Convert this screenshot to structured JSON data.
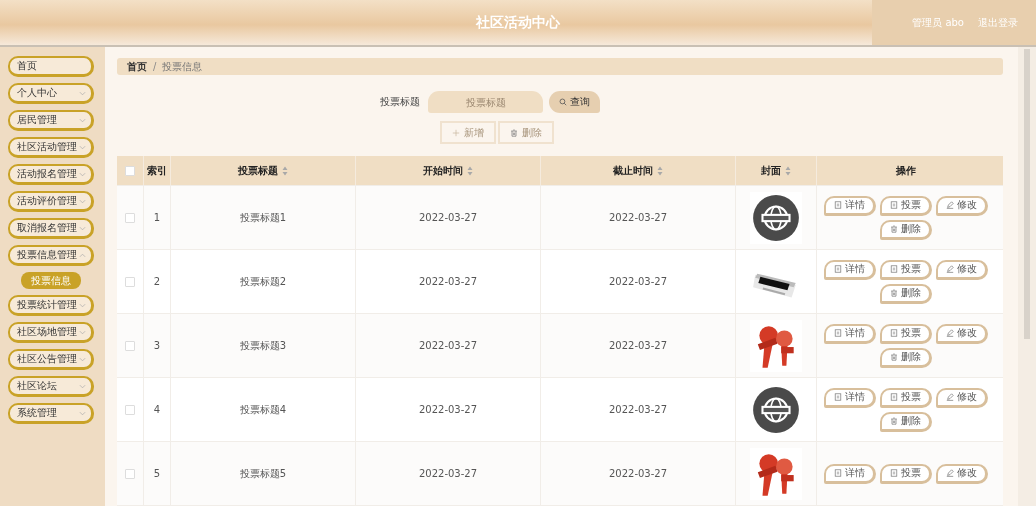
{
  "header": {
    "title": "社区活动中心",
    "user": "管理员 abo",
    "logout": "退出登录"
  },
  "sidebar": {
    "items": [
      {
        "label": "首页",
        "kind": "link"
      },
      {
        "label": "个人中心",
        "kind": "menu",
        "expanded": false
      },
      {
        "label": "居民管理",
        "kind": "menu",
        "expanded": false
      },
      {
        "label": "社区活动管理",
        "kind": "menu",
        "expanded": false
      },
      {
        "label": "活动报名管理",
        "kind": "menu",
        "expanded": false
      },
      {
        "label": "活动评价管理",
        "kind": "menu",
        "expanded": false
      },
      {
        "label": "取消报名管理",
        "kind": "menu",
        "expanded": false
      },
      {
        "label": "投票信息管理",
        "kind": "menu",
        "expanded": true,
        "children": [
          {
            "label": "投票信息",
            "selected": true
          }
        ]
      },
      {
        "label": "投票统计管理",
        "kind": "menu",
        "expanded": false
      },
      {
        "label": "社区场地管理",
        "kind": "menu",
        "expanded": false
      },
      {
        "label": "社区公告管理",
        "kind": "menu",
        "expanded": false
      },
      {
        "label": "社区论坛",
        "kind": "menu",
        "expanded": false
      },
      {
        "label": "系统管理",
        "kind": "menu",
        "expanded": false
      }
    ]
  },
  "breadcrumb": {
    "separator": "/",
    "items": [
      "首页",
      "投票信息"
    ]
  },
  "search": {
    "label": "投票标题",
    "placeholder": "投票标题",
    "button": "查询"
  },
  "toolbar": [
    {
      "label": "新增",
      "kind": "add"
    },
    {
      "label": "删除",
      "kind": "delete"
    }
  ],
  "table": {
    "select_all_checked": false,
    "columns": [
      {
        "label": "索引",
        "sortable": false
      },
      {
        "label": "投票标题",
        "sortable": true
      },
      {
        "label": "开始时间",
        "sortable": true
      },
      {
        "label": "截止时间",
        "sortable": true
      },
      {
        "label": "封面",
        "sortable": true
      },
      {
        "label": "操作",
        "sortable": false
      }
    ],
    "rows": [
      {
        "checked": false,
        "index": "1",
        "title": "投票标题1",
        "start": "2022-03-27",
        "end": "2022-03-27",
        "cover": {
          "kind": "picture"
        },
        "actions": [
          {
            "label": "详情",
            "kind": "detail"
          },
          {
            "label": "投票",
            "kind": "vote"
          },
          {
            "label": "修改",
            "kind": "edit"
          },
          {
            "label": "删除",
            "kind": "delete"
          }
        ]
      },
      {
        "checked": false,
        "index": "2",
        "title": "投票标题2",
        "start": "2022-03-27",
        "end": "2022-03-27",
        "cover": {
          "kind": "picture"
        },
        "actions": [
          {
            "label": "详情",
            "kind": "detail"
          },
          {
            "label": "投票",
            "kind": "vote"
          },
          {
            "label": "修改",
            "kind": "edit"
          },
          {
            "label": "删除",
            "kind": "delete"
          }
        ]
      },
      {
        "checked": false,
        "index": "3",
        "title": "投票标题3",
        "start": "2022-03-27",
        "end": "2022-03-27",
        "cover": {
          "kind": "picture"
        },
        "actions": [
          {
            "label": "详情",
            "kind": "detail"
          },
          {
            "label": "投票",
            "kind": "vote"
          },
          {
            "label": "修改",
            "kind": "edit"
          },
          {
            "label": "删除",
            "kind": "delete"
          }
        ]
      },
      {
        "checked": false,
        "index": "4",
        "title": "投票标题4",
        "start": "2022-03-27",
        "end": "2022-03-27",
        "cover": {
          "kind": "picture"
        },
        "actions": [
          {
            "label": "详情",
            "kind": "detail"
          },
          {
            "label": "投票",
            "kind": "vote"
          },
          {
            "label": "修改",
            "kind": "edit"
          },
          {
            "label": "删除",
            "kind": "delete"
          }
        ]
      },
      {
        "checked": false,
        "index": "5",
        "title": "投票标题5",
        "start": "2022-03-27",
        "end": "2022-03-27",
        "cover": {
          "kind": "picture"
        },
        "actions": [
          {
            "label": "详情",
            "kind": "detail"
          },
          {
            "label": "投票",
            "kind": "vote"
          },
          {
            "label": "修改",
            "kind": "edit"
          }
        ]
      }
    ]
  }
}
